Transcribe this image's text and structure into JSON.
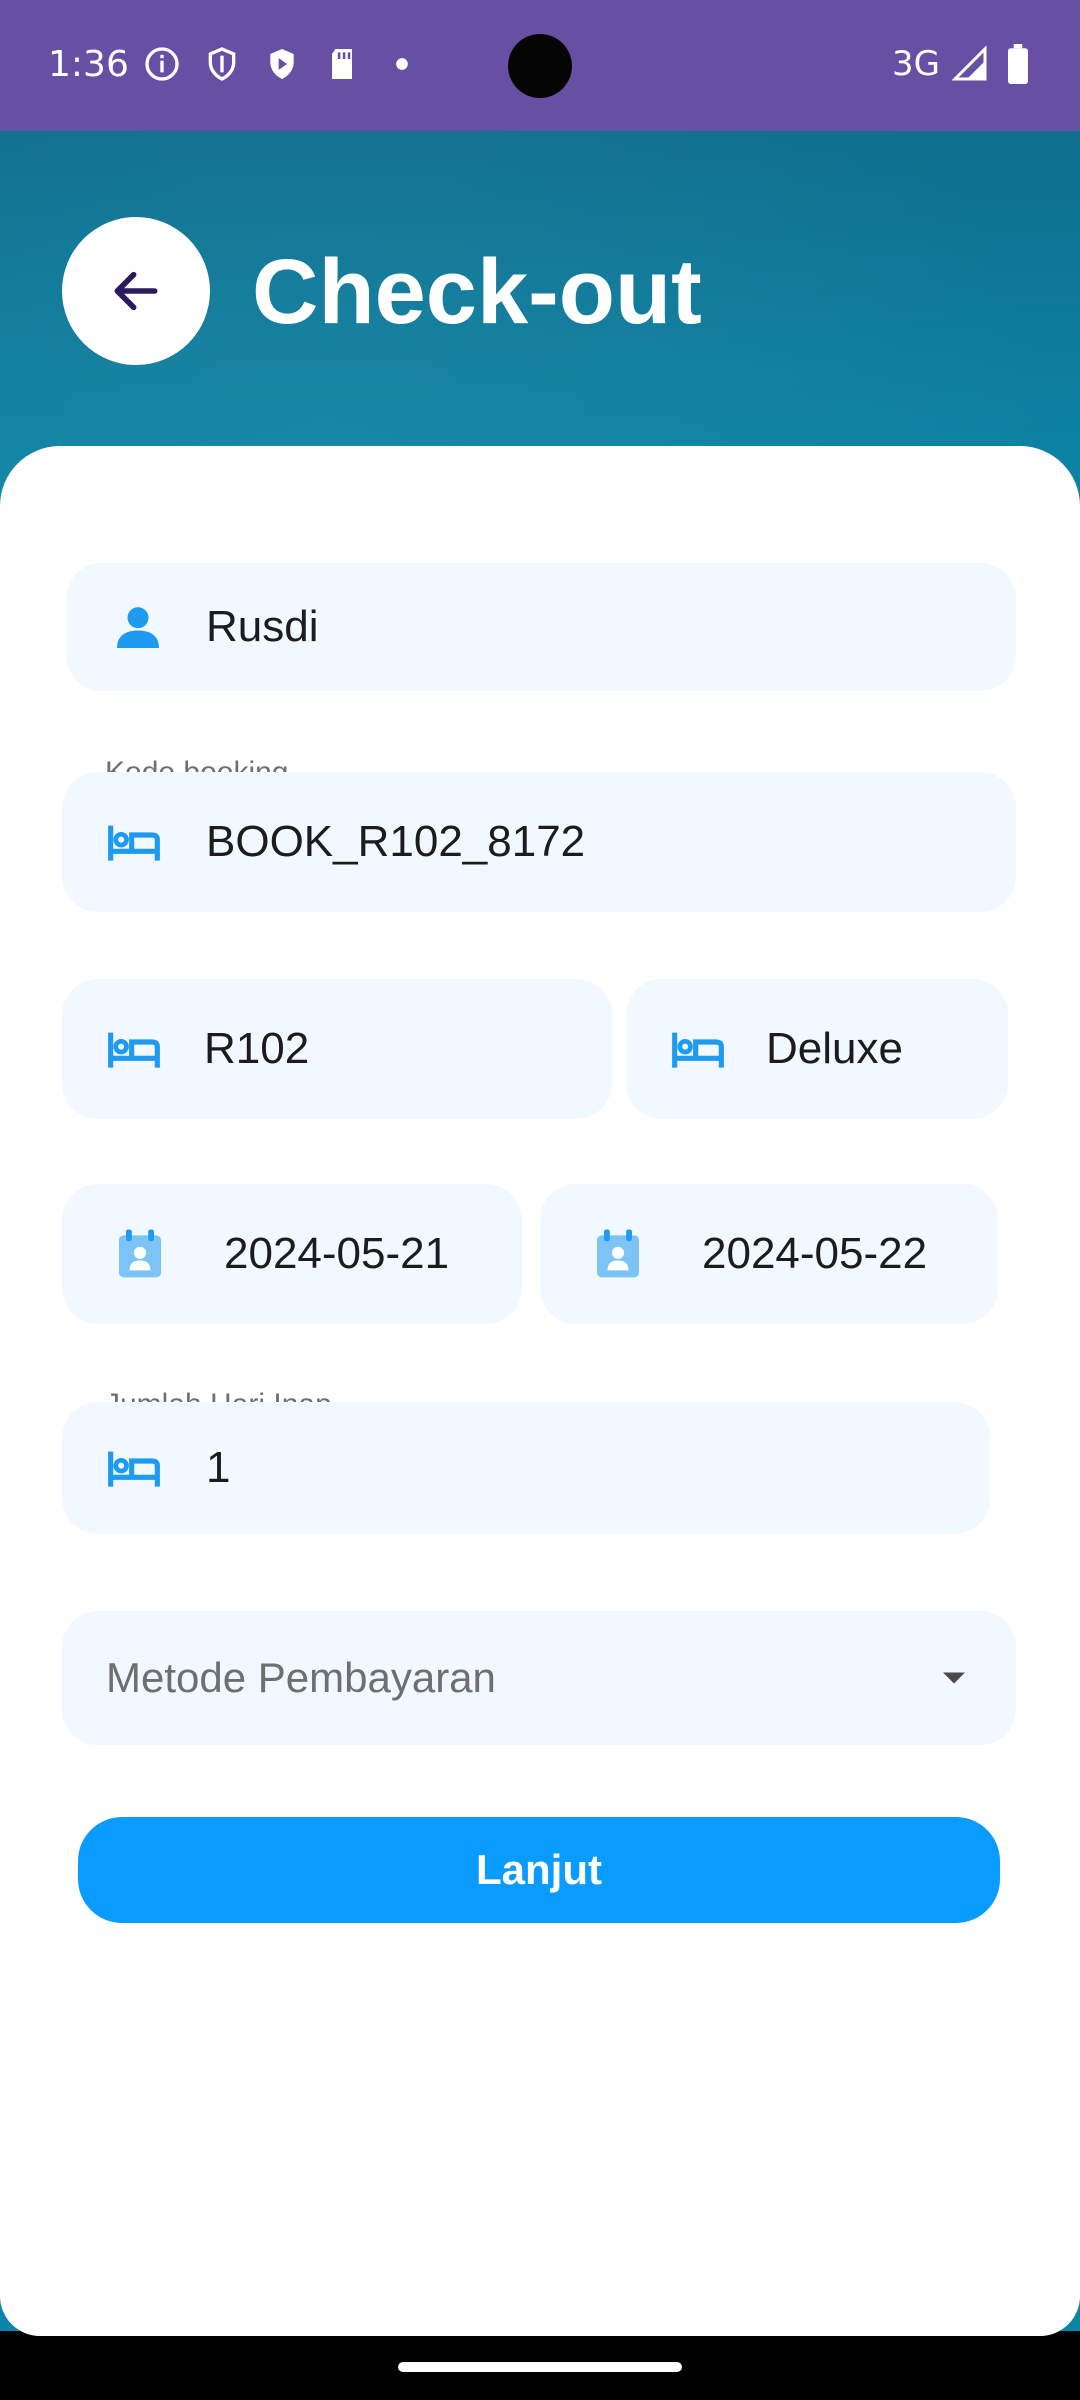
{
  "status_bar": {
    "time": "1:36",
    "network": "3G"
  },
  "header": {
    "title": "Check-out"
  },
  "form": {
    "guest_name": "Rusdi",
    "booking_code_label": "Kode booking",
    "booking_code": "BOOK_R102_8172",
    "room_number": "R102",
    "room_type": "Deluxe",
    "check_in_date": "2024-05-21",
    "check_out_date": "2024-05-22",
    "nights_label": "Jumlah Hari Inap",
    "nights": "1",
    "payment_method_placeholder": "Metode Pembayaran"
  },
  "actions": {
    "next_label": "Lanjut"
  },
  "colors": {
    "status_bar": "#6750A4",
    "accent": "#0A9BFF",
    "field_bg": "#F1F8FF",
    "icon": "#1E9BF0"
  }
}
